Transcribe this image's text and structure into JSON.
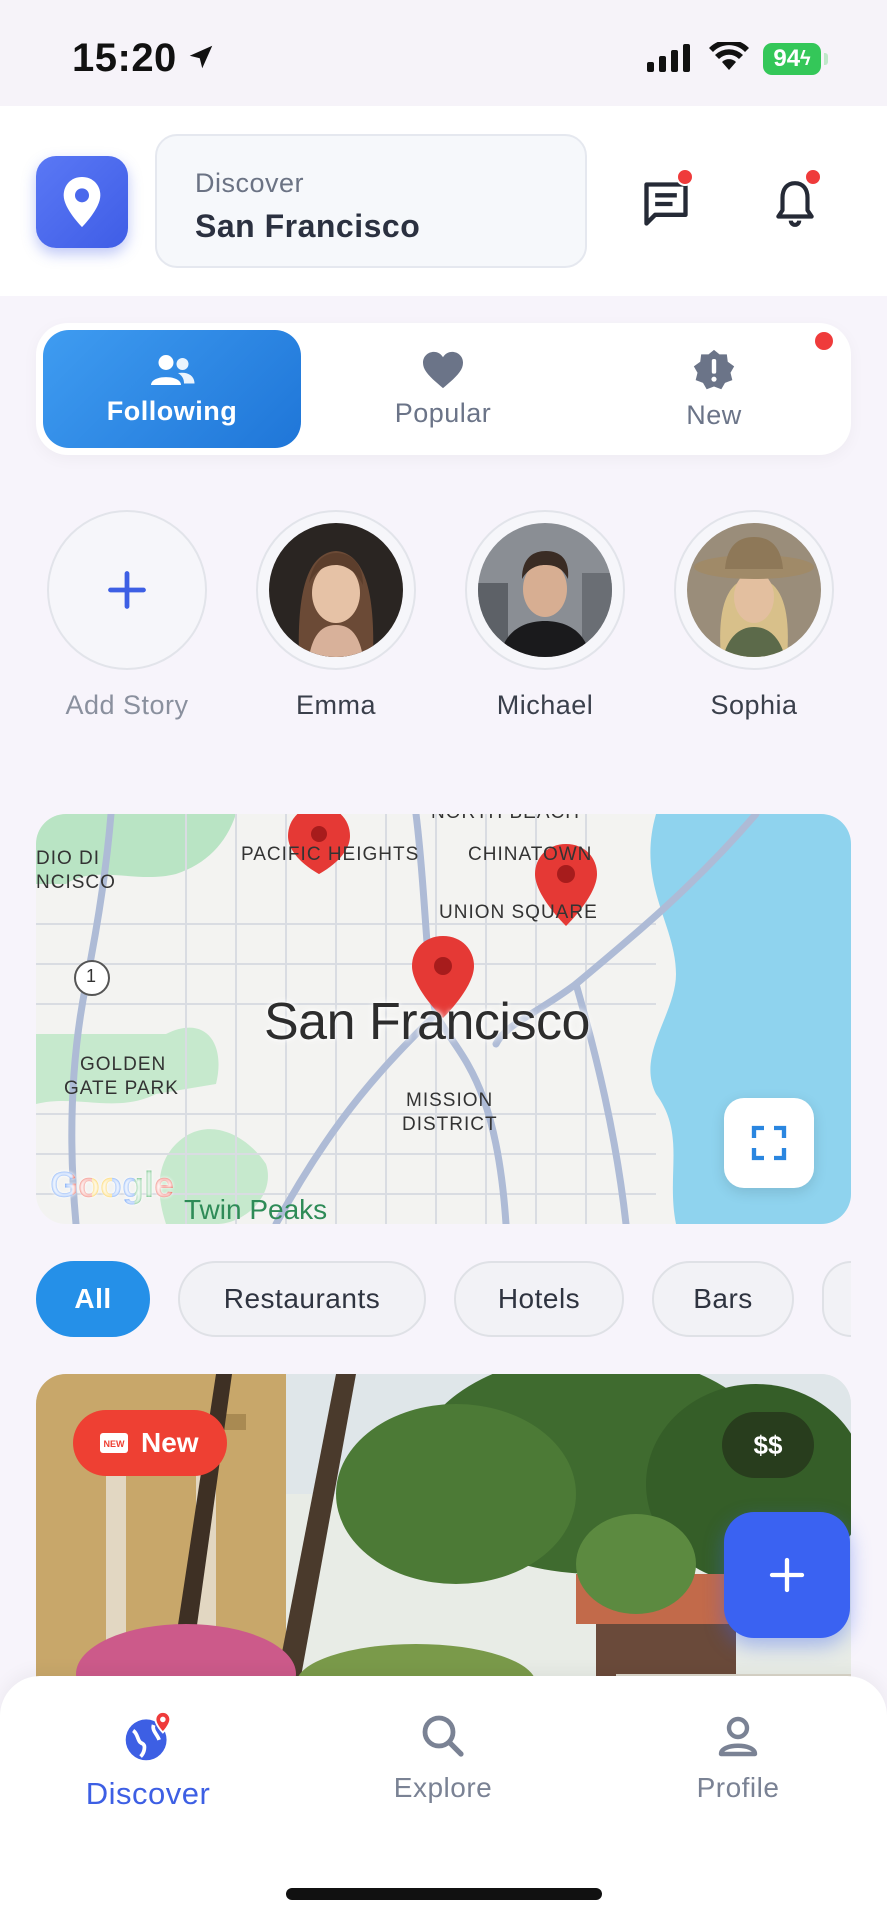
{
  "status_bar": {
    "time": "15:20",
    "battery": "94"
  },
  "header": {
    "search_label": "Discover",
    "city": "San Francisco"
  },
  "tabs": [
    {
      "label": "Following",
      "icon": "users-icon",
      "active": true
    },
    {
      "label": "Popular",
      "icon": "heart-icon",
      "active": false
    },
    {
      "label": "New",
      "icon": "alert-badge-icon",
      "active": false
    }
  ],
  "stories": [
    {
      "name": "Add Story",
      "icon": "plus-icon"
    },
    {
      "name": "Emma"
    },
    {
      "name": "Michael"
    },
    {
      "name": "Sophia"
    }
  ],
  "map": {
    "labels": {
      "city": "San Francisco",
      "pacific_heights": "PACIFIC HEIGHTS",
      "north_beach": "NORTH BEACH",
      "chinatown": "CHINATOWN",
      "union_square": "UNION SQUARE",
      "golden_gate_1": "GOLDEN",
      "golden_gate_2": "GATE PARK",
      "mission_1": "MISSION",
      "mission_2": "DISTRICT",
      "presidio_1": "DIO DI",
      "presidio_2": "NCISCO",
      "twin_peaks": "Twin Peaks",
      "highway": "1",
      "google": "Google"
    }
  },
  "filters": [
    {
      "label": "All",
      "active": true
    },
    {
      "label": "Restaurants",
      "active": false
    },
    {
      "label": "Hotels",
      "active": false
    },
    {
      "label": "Bars",
      "active": false
    }
  ],
  "card": {
    "badge_new": "New",
    "price": "$$"
  },
  "bottom_nav": [
    {
      "label": "Discover",
      "icon": "globe-pin-icon",
      "active": true
    },
    {
      "label": "Explore",
      "icon": "search-icon",
      "active": false
    },
    {
      "label": "Profile",
      "icon": "user-icon",
      "active": false
    }
  ],
  "colors": {
    "primary": "#3d5fe4",
    "tab_active": "#2590e8",
    "notification_dot": "#ef3b3b",
    "badge_new": "#ee4033"
  }
}
